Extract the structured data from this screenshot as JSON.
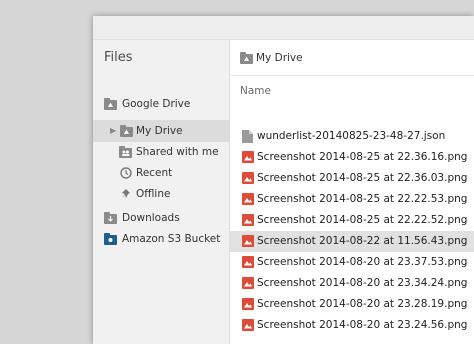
{
  "sidebar": {
    "title": "Files",
    "items": [
      {
        "label": "Google Drive",
        "icon": "drive-icon"
      },
      {
        "label": "My Drive",
        "icon": "my-drive-icon",
        "selected": true
      },
      {
        "label": "Shared with me",
        "icon": "shared-icon"
      },
      {
        "label": "Recent",
        "icon": "clock-icon"
      },
      {
        "label": "Offline",
        "icon": "pin-icon"
      },
      {
        "label": "Downloads",
        "icon": "download-icon"
      },
      {
        "label": "Amazon S3 Bucket",
        "icon": "s3-bucket-icon"
      }
    ]
  },
  "main": {
    "breadcrumb": "My Drive",
    "column_header": "Name",
    "files": [
      {
        "name": "wunderlist-20140825-23-48-27.json",
        "type": "json"
      },
      {
        "name": "Screenshot 2014-08-25 at 22.36.16.png",
        "type": "image"
      },
      {
        "name": "Screenshot 2014-08-25 at 22.36.03.png",
        "type": "image"
      },
      {
        "name": "Screenshot 2014-08-25 at 22.22.53.png",
        "type": "image"
      },
      {
        "name": "Screenshot 2014-08-25 at 22.22.52.png",
        "type": "image"
      },
      {
        "name": "Screenshot 2014-08-22 at 11.56.43.png",
        "type": "image",
        "selected": true
      },
      {
        "name": "Screenshot 2014-08-20 at 23.37.53.png",
        "type": "image"
      },
      {
        "name": "Screenshot 2014-08-20 at 23.34.24.png",
        "type": "image"
      },
      {
        "name": "Screenshot 2014-08-20 at 23.28.19.png",
        "type": "image"
      },
      {
        "name": "Screenshot 2014-08-20 at 23.24.56.png",
        "type": "image"
      }
    ]
  },
  "colors": {
    "image_icon": "#dd4b39",
    "folder_icon": "#8a8a8a",
    "selected_row": "#e1e1e1"
  }
}
